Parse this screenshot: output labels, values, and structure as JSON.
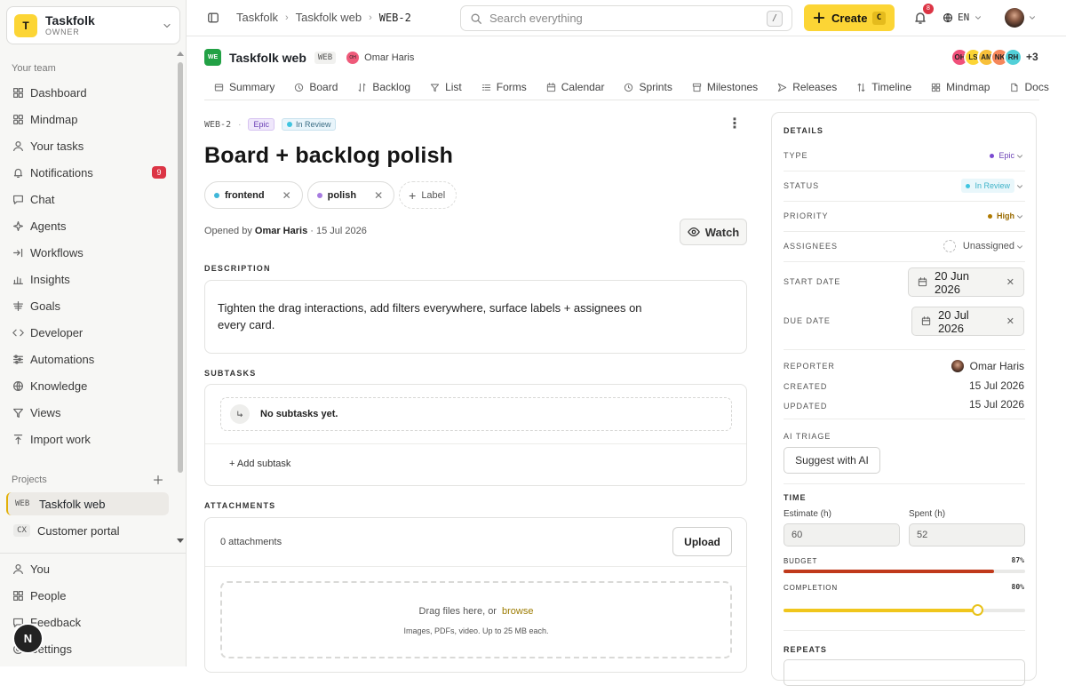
{
  "workspace": {
    "initial": "T",
    "name": "Taskfolk",
    "role": "OWNER"
  },
  "sidebar": {
    "team_label": "Your team",
    "items": [
      {
        "label": "Dashboard",
        "icon": "dashboard-icon"
      },
      {
        "label": "Mindmap",
        "icon": "mindmap-icon"
      },
      {
        "label": "Your tasks",
        "icon": "user-icon"
      },
      {
        "label": "Notifications",
        "icon": "bell-icon",
        "badge": "9"
      },
      {
        "label": "Chat",
        "icon": "chat-icon"
      },
      {
        "label": "Agents",
        "icon": "sparkle-icon"
      },
      {
        "label": "Workflows",
        "icon": "workflow-icon"
      },
      {
        "label": "Insights",
        "icon": "chart-icon"
      },
      {
        "label": "Goals",
        "icon": "goal-icon"
      },
      {
        "label": "Developer",
        "icon": "code-icon"
      },
      {
        "label": "Automations",
        "icon": "sliders-icon"
      },
      {
        "label": "Knowledge",
        "icon": "globe-icon"
      },
      {
        "label": "Views",
        "icon": "filter-icon"
      },
      {
        "label": "Import work",
        "icon": "upload-icon"
      }
    ],
    "projects_label": "Projects",
    "projects": [
      {
        "code": "WEB",
        "name": "Taskfolk web"
      },
      {
        "code": "CX",
        "name": "Customer portal"
      }
    ],
    "bottom": [
      {
        "label": "You"
      },
      {
        "label": "People"
      },
      {
        "label": "Feedback"
      },
      {
        "label": "Settings"
      }
    ],
    "user_initial": "N"
  },
  "topbar": {
    "breadcrumb": [
      "Taskfolk",
      "Taskfolk web",
      "WEB-2"
    ],
    "search_placeholder": "Search everything",
    "search_shortcut": "/",
    "create_label": "Create",
    "create_shortcut": "C",
    "notif_count": "8",
    "language": "EN"
  },
  "project": {
    "logo": "WE",
    "name": "Taskfolk web",
    "code": "WEB",
    "owner_initials": "OH",
    "owner_name": "Omar Haris",
    "members": [
      {
        "initials": "OH",
        "color": "#f0507a"
      },
      {
        "initials": "LS",
        "color": "#fcd535"
      },
      {
        "initials": "AM",
        "color": "#f8c03a"
      },
      {
        "initials": "NK",
        "color": "#f5865a"
      },
      {
        "initials": "RH",
        "color": "#52d0d8"
      }
    ],
    "members_more": "+3"
  },
  "tabs": [
    {
      "label": "Summary",
      "icon": "summary-icon"
    },
    {
      "label": "Board",
      "icon": "board-icon"
    },
    {
      "label": "Backlog",
      "icon": "backlog-icon"
    },
    {
      "label": "List",
      "icon": "list-icon"
    },
    {
      "label": "Forms",
      "icon": "forms-icon"
    },
    {
      "label": "Calendar",
      "icon": "calendar-icon"
    },
    {
      "label": "Sprints",
      "icon": "sprint-icon"
    },
    {
      "label": "Milestones",
      "icon": "milestone-icon"
    },
    {
      "label": "Releases",
      "icon": "release-icon"
    },
    {
      "label": "Timeline",
      "icon": "timeline-icon"
    },
    {
      "label": "Mindmap",
      "icon": "mindmap-icon"
    },
    {
      "label": "Docs",
      "icon": "docs-icon"
    }
  ],
  "issue": {
    "key": "WEB-2",
    "type_chip": "Epic",
    "status_chip": "In Review",
    "title": "Board + backlog polish",
    "labels": [
      {
        "name": "frontend",
        "color": "#3fb7d9"
      },
      {
        "name": "polish",
        "color": "#a77be0"
      }
    ],
    "add_label": "Label",
    "opened_prefix": "Opened by",
    "opened_by": "Omar Haris",
    "opened_date": "· 15 Jul 2026",
    "watch_label": "Watch",
    "description_heading": "DESCRIPTION",
    "description": "Tighten the drag interactions, add filters everywhere, surface labels + assignees on every card.",
    "subtasks_heading": "SUBTASKS",
    "subtasks_empty": "No subtasks yet.",
    "add_subtask": "+ Add subtask",
    "attachments_heading": "ATTACHMENTS",
    "attachments_count": "0 attachments",
    "upload_label": "Upload",
    "drop_text": "Drag files here, or",
    "drop_link": "browse",
    "drop_hint": "Images, PDFs, video. Up to 25 MB each."
  },
  "details": {
    "heading": "DETAILS",
    "type_label": "TYPE",
    "type_value": "Epic",
    "status_label": "STATUS",
    "status_value": "In Review",
    "priority_label": "PRIORITY",
    "priority_value": "High",
    "assignees_label": "ASSIGNEES",
    "assignees_value": "Unassigned",
    "start_label": "START DATE",
    "start_value": "20 Jun 2026",
    "due_label": "DUE DATE",
    "due_value": "20 Jul 2026",
    "reporter_label": "REPORTER",
    "reporter_value": "Omar Haris",
    "created_label": "CREATED",
    "created_value": "15 Jul 2026",
    "updated_label": "UPDATED",
    "updated_value": "15 Jul 2026",
    "ai_label": "AI TRIAGE",
    "ai_button": "Suggest with AI",
    "time_heading": "TIME",
    "estimate_label": "Estimate (h)",
    "estimate_value": "60",
    "spent_label": "Spent (h)",
    "spent_value": "52",
    "budget_label": "BUDGET",
    "budget_pct": "87%",
    "budget_fraction": 0.87,
    "completion_label": "COMPLETION",
    "completion_pct": "80%",
    "completion_fraction": 0.8,
    "repeats_label": "REPEATS"
  },
  "colors": {
    "accent": "#fcd535",
    "epic": "#7b4ad1",
    "review": "#3fc5e0",
    "high": "#b07a00",
    "budget": "#c0391b",
    "completion": "#f0c61c"
  }
}
